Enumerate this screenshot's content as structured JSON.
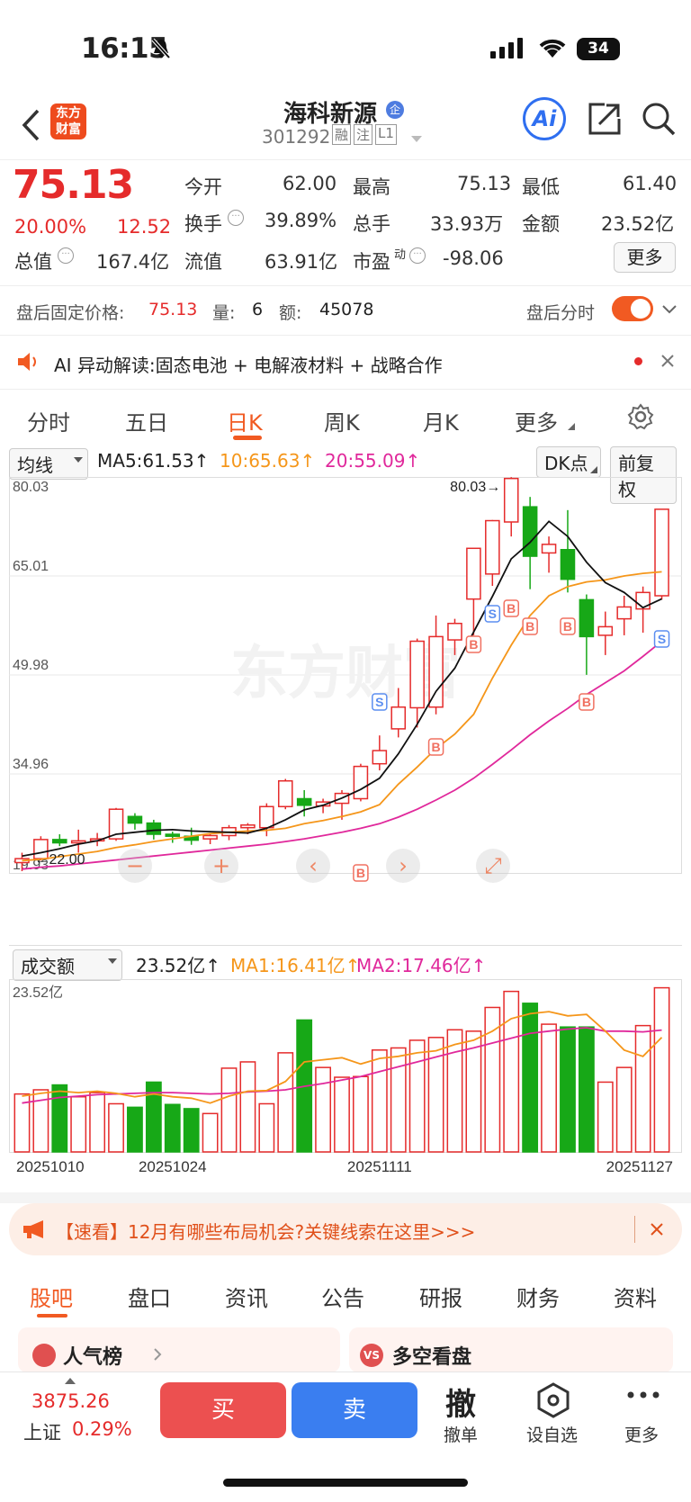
{
  "status": {
    "time": "16:15",
    "battery": "34"
  },
  "header": {
    "name": "海科新源",
    "code": "301292",
    "tags": [
      "融",
      "注",
      "L1"
    ],
    "ai_label": "Ai"
  },
  "quote": {
    "price": "75.13",
    "pct": "20.00%",
    "chg": "12.52",
    "open_label": "今开",
    "open": "62.00",
    "high_label": "最高",
    "high": "75.13",
    "low_label": "最低",
    "low": "61.40",
    "turnover_label": "换手",
    "turnover": "39.89%",
    "vol_label": "总手",
    "vol": "33.93万",
    "amt_label": "金额",
    "amt": "23.52亿",
    "mcap_label": "总值",
    "mcap": "167.4亿",
    "float_label": "流值",
    "float": "63.91亿",
    "pe_label": "市盈",
    "pe_sup": "动",
    "pe": "-98.06",
    "more": "更多"
  },
  "afterhours": {
    "label": "盘后固定价格:",
    "price": "75.13",
    "vol_label": "量:",
    "vol": "6",
    "amt_label": "额:",
    "amt": "45078",
    "toggle_label": "盘后分时",
    "toggle_on": true
  },
  "ai_bar": {
    "text": "AI 异动解读:固态电池 + 电解液材料 + 战略合作"
  },
  "chart_tabs": [
    "分时",
    "五日",
    "日K",
    "周K",
    "月K",
    "更多"
  ],
  "active_tab": "日K",
  "ma_bar": {
    "select": "均线",
    "ma5": "MA5:61.53↑",
    "ma10": "10:65.63↑",
    "ma20": "20:55.09↑",
    "dk": "DK点",
    "fq": "前复权"
  },
  "chart_data": {
    "type": "candlestick",
    "y_ticks": [
      "80.03",
      "65.01",
      "49.98",
      "34.96",
      "19.93"
    ],
    "ylim": [
      19.93,
      80.03
    ],
    "max_label": "80.03→",
    "min_label": "←22.00",
    "watermark": "东方财富",
    "candles": [
      [
        21.5,
        23.0,
        20.2,
        22.1
      ],
      [
        22.1,
        25.5,
        21.8,
        25.0
      ],
      [
        25.0,
        25.8,
        24.0,
        24.5
      ],
      [
        24.5,
        26.5,
        23.0,
        24.8
      ],
      [
        24.8,
        26.0,
        24.0,
        25.1
      ],
      [
        25.1,
        29.8,
        24.8,
        29.6
      ],
      [
        28.5,
        29.0,
        26.5,
        27.5
      ],
      [
        27.5,
        28.0,
        25.0,
        25.8
      ],
      [
        25.8,
        26.2,
        24.5,
        25.5
      ],
      [
        25.5,
        26.8,
        24.2,
        24.9
      ],
      [
        25.1,
        26.0,
        24.3,
        25.6
      ],
      [
        25.6,
        27.2,
        24.9,
        26.8
      ],
      [
        26.8,
        27.5,
        25.8,
        27.2
      ],
      [
        26.8,
        30.5,
        25.5,
        30.0
      ],
      [
        30.0,
        34.2,
        29.6,
        33.9
      ],
      [
        31.2,
        32.5,
        28.5,
        30.2
      ],
      [
        30.1,
        31.2,
        29.0,
        30.7
      ],
      [
        30.5,
        32.5,
        28.0,
        32.0
      ],
      [
        31.2,
        36.5,
        30.8,
        36.1
      ],
      [
        36.5,
        40.8,
        35.5,
        38.5
      ],
      [
        41.8,
        48.0,
        40.5,
        45.1
      ],
      [
        45.0,
        55.5,
        42.0,
        55.1
      ],
      [
        45.1,
        59.0,
        44.0,
        55.8
      ],
      [
        55.3,
        58.5,
        53.0,
        57.8
      ],
      [
        61.5,
        68.5,
        56.0,
        69.2
      ],
      [
        65.3,
        73.5,
        63.5,
        73.4
      ],
      [
        73.2,
        80.0,
        71.0,
        79.8
      ],
      [
        75.5,
        77.0,
        63.0,
        68.0
      ],
      [
        68.5,
        71.0,
        65.5,
        69.8
      ],
      [
        69.0,
        75.0,
        62.5,
        64.5
      ],
      [
        61.4,
        62.2,
        50.0,
        55.8
      ],
      [
        56.0,
        59.6,
        53.0,
        57.3
      ],
      [
        58.5,
        62.0,
        56.0,
        60.3
      ],
      [
        60.0,
        63.4,
        56.4,
        62.5
      ],
      [
        62.0,
        75.13,
        61.4,
        75.13
      ]
    ],
    "ma5": [
      22.5,
      23.0,
      23.6,
      24.3,
      24.8,
      25.8,
      26.1,
      26.4,
      26.5,
      26.3,
      26.2,
      26.1,
      26.0,
      26.7,
      28.0,
      29.5,
      30.2,
      31.3,
      32.6,
      34.3,
      38.0,
      42.5,
      47.5,
      51.0,
      56.5,
      61.9,
      67.6,
      70.1,
      73.3,
      71.0,
      67.1,
      64.0,
      62.5,
      60.2,
      61.53
    ],
    "ma10": [
      21.8,
      22.0,
      22.4,
      22.8,
      23.2,
      23.8,
      24.2,
      24.7,
      25.1,
      25.5,
      25.9,
      26.1,
      26.3,
      26.4,
      26.7,
      27.4,
      27.9,
      28.5,
      29.2,
      30.3,
      33.4,
      36.0,
      38.8,
      41.0,
      44.0,
      49.5,
      54.5,
      59.0,
      62.0,
      63.4,
      64.1,
      64.4,
      65.0,
      65.4,
      65.63
    ],
    "ma20": [
      20.5,
      20.8,
      21.0,
      21.3,
      21.6,
      21.9,
      22.2,
      22.5,
      22.8,
      23.1,
      23.4,
      23.7,
      24.0,
      24.3,
      24.7,
      25.1,
      25.6,
      26.1,
      26.7,
      27.4,
      28.4,
      29.6,
      31.0,
      32.5,
      34.3,
      36.4,
      38.6,
      40.9,
      43.0,
      44.9,
      47.0,
      48.8,
      50.6,
      52.8,
      55.09
    ],
    "x_labels": [
      "20251010",
      "20251024",
      "20251111",
      "20251127"
    ],
    "volume_bar": {
      "select": "成交额",
      "value": "23.52亿↑",
      "ma1": "MA1:16.41亿↑",
      "ma2": "MA2:17.46亿↑",
      "top": "23.52亿"
    },
    "volumes": [
      8.3,
      8.9,
      9.6,
      7.9,
      8.5,
      6.9,
      6.4,
      10.0,
      6.8,
      6.2,
      5.5,
      12.0,
      12.9,
      6.9,
      14.2,
      18.9,
      12.1,
      10.7,
      10.8,
      14.6,
      14.9,
      16.0,
      16.4,
      17.5,
      17.3,
      20.7,
      23.0,
      21.3,
      18.3,
      17.9,
      17.9,
      10.0,
      12.1,
      18.1,
      23.52
    ],
    "vol_ma1": [
      8.0,
      8.4,
      8.7,
      8.5,
      8.7,
      8.4,
      7.9,
      8.3,
      7.9,
      7.7,
      7.0,
      8.0,
      8.7,
      8.8,
      10.1,
      12.9,
      13.2,
      13.5,
      12.6,
      13.4,
      13.7,
      14.2,
      14.5,
      15.4,
      16.0,
      17.3,
      19.1,
      19.8,
      20.1,
      19.5,
      19.7,
      17.3,
      14.6,
      13.7,
      16.41
    ],
    "vol_ma2": [
      7.0,
      7.4,
      7.8,
      8.0,
      8.2,
      8.3,
      8.4,
      8.5,
      8.5,
      8.4,
      8.3,
      8.4,
      8.6,
      8.7,
      8.9,
      9.4,
      9.8,
      10.3,
      10.8,
      11.5,
      12.2,
      12.9,
      13.6,
      14.3,
      14.9,
      15.6,
      16.3,
      17.0,
      17.3,
      17.6,
      17.8,
      17.3,
      17.3,
      17.2,
      17.46
    ]
  },
  "promo": {
    "text": "【速看】12月有哪些布局机会?关键线索在这里>>>"
  },
  "bottom_tabs": [
    "股吧",
    "盘口",
    "资讯",
    "公告",
    "研报",
    "财务",
    "资料"
  ],
  "active_bottom": "股吧",
  "cards": [
    "人气榜",
    "多空看盘"
  ],
  "footer": {
    "index_value": "3875.26",
    "index_name": "上证",
    "index_pct": "0.29%",
    "buy": "买",
    "sell": "卖",
    "cancel_big": "撤",
    "cancel": "撤单",
    "watch": "设自选",
    "more": "更多"
  }
}
